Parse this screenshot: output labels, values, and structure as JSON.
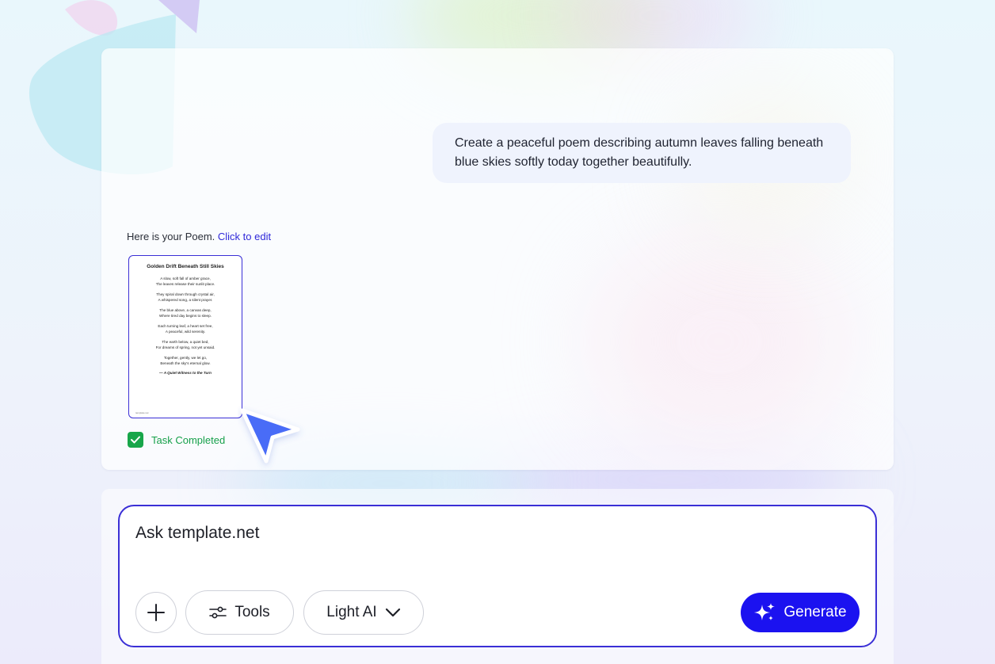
{
  "chat": {
    "user_message": "Create a peaceful poem describing autumn leaves falling beneath blue skies softly today together beautifully.",
    "reply_prefix": "Here is your Poem.",
    "reply_link": "Click to edit",
    "task_status": "Task Completed"
  },
  "document": {
    "title": "Golden Drift Beneath Still Skies",
    "stanzas": [
      [
        "A slow, soft fall of amber grace,",
        "The leaves release their sunlit place."
      ],
      [
        "They spiral down through crystal air,",
        "A whispered song, a silent prayer."
      ],
      [
        "The blue above, a canvas deep,",
        "Where tired day begins to sleep."
      ],
      [
        "Each turning leaf, a heart set free,",
        "A peaceful, wild serenity."
      ],
      [
        "The earth below, a quiet bed,",
        "For dreams of spring, not yet unsaid."
      ],
      [
        "Together, gently, we let go,",
        "Beneath the sky's eternal glow."
      ]
    ],
    "signature": "— A Quiet Witness to the Turn",
    "footer": "template.net"
  },
  "composer": {
    "placeholder": "Ask template.net",
    "tools_label": "Tools",
    "model_label": "Light AI",
    "generate_label": "Generate"
  },
  "colors": {
    "accent": "#1b12f0",
    "border_accent": "#3a2fd6",
    "success": "#18a64a",
    "link": "#2f28d9"
  }
}
